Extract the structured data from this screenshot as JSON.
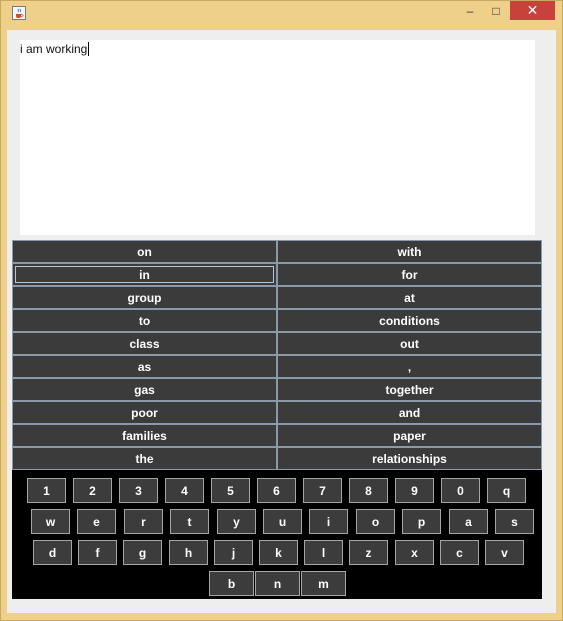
{
  "window": {
    "minimize_glyph": "–",
    "maximize_glyph": "□",
    "close_glyph": "✕"
  },
  "editor": {
    "text": "i am working"
  },
  "suggestions": [
    "on",
    "with",
    "in",
    "for",
    "group",
    "at",
    "to",
    "conditions",
    "class",
    "out",
    "as",
    ",",
    "gas",
    "together",
    "poor",
    "and",
    "families",
    "paper",
    "the",
    "relationships"
  ],
  "suggestion_focus_index": 2,
  "keyboard": {
    "rows": [
      [
        "1",
        "2",
        "3",
        "4",
        "5",
        "6",
        "7",
        "8",
        "9",
        "0",
        "q"
      ],
      [
        "w",
        "e",
        "r",
        "t",
        "y",
        "u",
        "i",
        "o",
        "p",
        "a",
        "s"
      ],
      [
        "d",
        "f",
        "g",
        "h",
        "j",
        "k",
        "l",
        "z",
        "x",
        "c",
        "v"
      ],
      [
        "b",
        "n",
        "m"
      ]
    ]
  },
  "colors": {
    "key_bg": "#3c3c3c",
    "keyboard_bg": "#000000",
    "frame": "#eed08a",
    "close": "#c9413b"
  }
}
